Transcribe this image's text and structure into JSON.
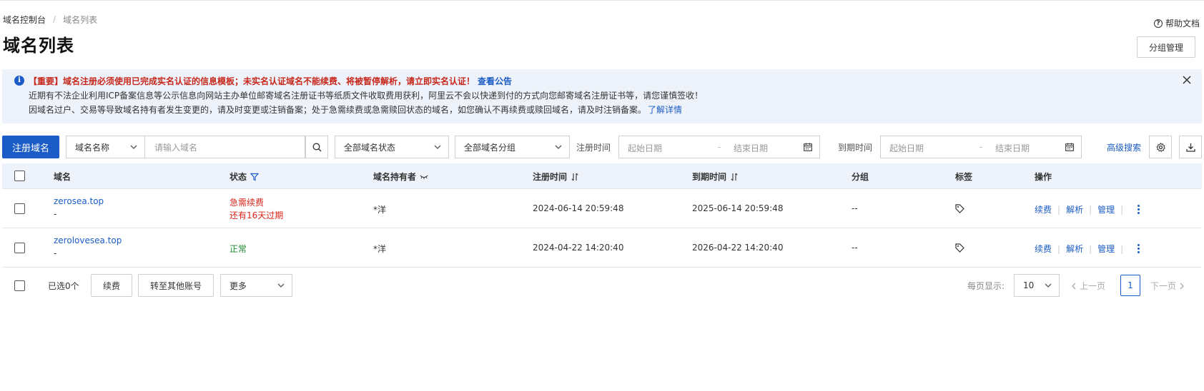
{
  "breadcrumb": [
    "域名控制台",
    "域名列表"
  ],
  "help_label": "帮助文档",
  "page_title": "域名列表",
  "group_mgmt_label": "分组管理",
  "notice": {
    "line1": "【重要】域名注册必须使用已完成实名认证的信息模板；未实名认证域名不能续费、将被暂停解析，请立即实名认证！",
    "line1_link": "查看公告",
    "line2": "近期有不法企业利用ICP备案信息等公示信息向网站主办单位邮寄域名注册证书等纸质文件收取费用获利，阿里云不会以快递到付的方式向您邮寄域名注册证书等，请您谨慎签收！",
    "line3": "因域名过户、交易等导致域名持有者发生变更的，请及时变更或注销备案；处于急需续费或急需赎回状态的域名，如您确认不再续费或赎回域名，请及时注销备案。",
    "line3_link": "了解详情"
  },
  "toolbar": {
    "register_label": "注册域名",
    "search_field_select": "域名名称",
    "search_placeholder": "请输入域名",
    "status_select": "全部域名状态",
    "group_select": "全部域名分组",
    "reg_time_label": "注册时间",
    "reg_start": "起始日期",
    "reg_sep": "-",
    "reg_end": "结束日期",
    "exp_time_label": "到期时间",
    "exp_start": "起始日期",
    "exp_sep": "-",
    "exp_end": "结束日期",
    "advanced_search": "高级搜索"
  },
  "table": {
    "headers": {
      "domain": "域名",
      "status": "状态",
      "owner": "域名持有者",
      "reg_time": "注册时间",
      "exp_time": "到期时间",
      "group": "分组",
      "tag": "标签",
      "ops": "操作"
    },
    "rows": [
      {
        "domain": "zerosea.top",
        "sub": "-",
        "status": "急需续费",
        "status_sub": "还有16天过期",
        "owner": "*洋",
        "reg_time": "2024-06-14 20:59:48",
        "exp_time": "2025-06-14 20:59:48",
        "group": "--"
      },
      {
        "domain": "zerolovesea.top",
        "sub": "-",
        "status": "正常",
        "status_sub": "",
        "owner": "*洋",
        "reg_time": "2024-04-22 14:20:40",
        "exp_time": "2026-04-22 14:20:40",
        "group": "--"
      }
    ],
    "ops": {
      "renew": "续费",
      "resolve": "解析",
      "manage": "管理"
    }
  },
  "footer": {
    "selected": "已选0个",
    "renew_btn": "续费",
    "transfer_btn": "转至其他账号",
    "more_select": "更多",
    "page_size_label": "每页显示:",
    "page_size": "10",
    "prev": "上一页",
    "current_page": "1",
    "next": "下一页"
  },
  "colors": {
    "primary": "#1b5cc6",
    "danger": "#d9241a",
    "success": "#1f8a2e",
    "notice_bg": "#eef3fb"
  }
}
